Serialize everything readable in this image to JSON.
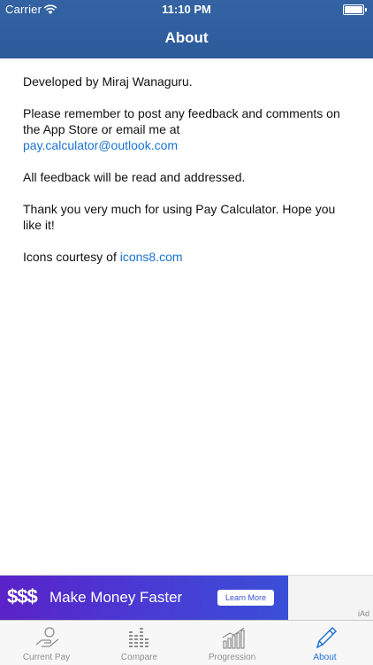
{
  "status_bar": {
    "carrier": "Carrier",
    "time": "11:10 PM"
  },
  "nav": {
    "title": "About"
  },
  "content": {
    "developer": "Developed by Miraj Wanaguru.",
    "feedback_line": "Please remember to post any feedback and comments on the App Store or email me at",
    "email": "pay.calculator@outlook.com",
    "addressed": "All feedback will be read and addressed.",
    "thanks": "Thank you very much for using Pay Calculator. Hope you like it!",
    "icons_prefix": "Icons courtesy of",
    "icons_link": "icons8.com"
  },
  "ad": {
    "dollar": "$$$",
    "headline": "Make Money Faster",
    "button": "Learn More",
    "network": "iAd"
  },
  "tabs": [
    {
      "label": "Current Pay",
      "icon": "hand-money-icon",
      "active": false
    },
    {
      "label": "Compare",
      "icon": "equalizer-icon",
      "active": false
    },
    {
      "label": "Progression",
      "icon": "growth-chart-icon",
      "active": false
    },
    {
      "label": "About",
      "icon": "pencil-icon",
      "active": true
    }
  ],
  "colors": {
    "nav_bar": "#2f5fa0",
    "link": "#1a73d1",
    "active_tab": "#1a6fd6",
    "inactive_tab": "#8e8e8e"
  }
}
